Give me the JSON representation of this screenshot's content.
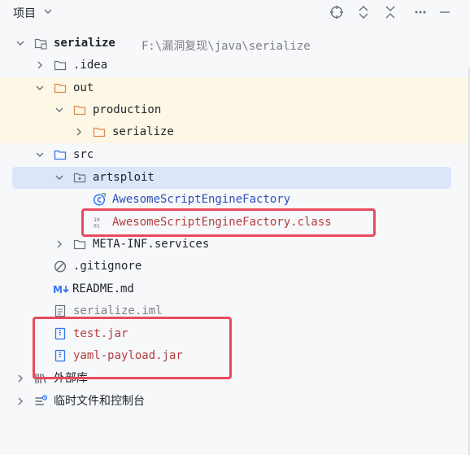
{
  "header": {
    "title": "项目",
    "icons": [
      "chevron-down-icon",
      "locate-icon",
      "expand-all-icon",
      "collapse-all-icon",
      "minimize-icon"
    ]
  },
  "tree": {
    "root": {
      "name": "serialize",
      "path": "F:\\漏洞复现\\java\\serialize"
    },
    "idea": ".idea",
    "out": "out",
    "production": "production",
    "production_serialize": "serialize",
    "src": "src",
    "artsploit": "artsploit",
    "factory_java": "AwesomeScriptEngineFactory",
    "factory_class": "AwesomeScriptEngineFactory.class",
    "meta_inf": "META-INF.services",
    "gitignore": ".gitignore",
    "readme": "README.md",
    "iml": "serialize.iml",
    "test_jar": "test.jar",
    "yaml_jar": "yaml-payload.jar",
    "external_libs": "外部库",
    "scratches": "临时文件和控制台"
  },
  "colors": {
    "modified": "#b43d3d",
    "reference": "#2d4fbd",
    "highlight_row": "#fdf7e5",
    "selected_row": "#dbe6fb",
    "annotation_box": "#e84a5f"
  }
}
